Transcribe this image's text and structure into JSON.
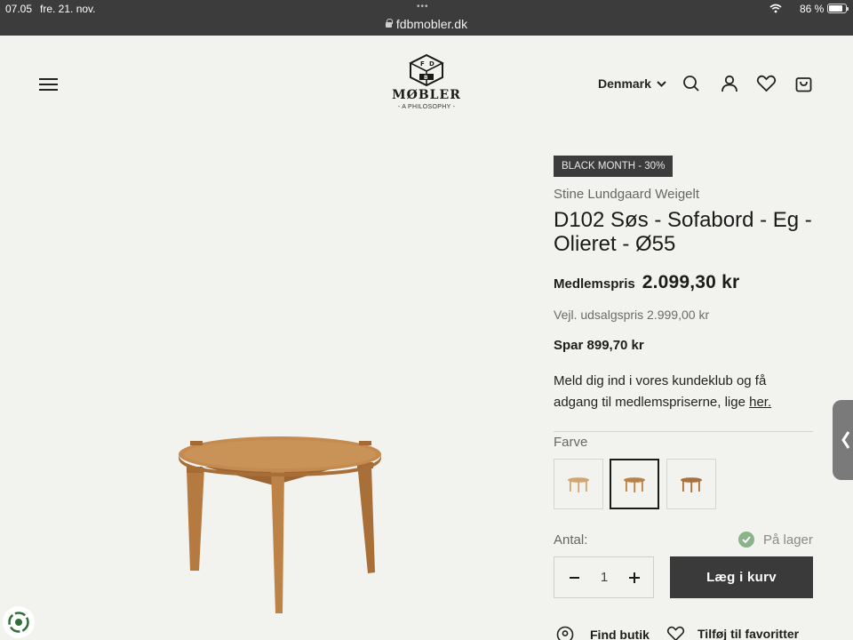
{
  "status_bar": {
    "time": "07.05",
    "date": "fre. 21. nov.",
    "url": "fdbmobler.dk",
    "battery": "86 %",
    "battery_level": 0.86
  },
  "header": {
    "logo_name": "MØBLER",
    "logo_tagline": "- A PHILOSOPHY -",
    "country": "Denmark",
    "icons": [
      "menu-icon",
      "search-icon",
      "account-icon",
      "heart-icon",
      "cart-icon"
    ]
  },
  "product": {
    "badge": "BLACK MONTH - 30%",
    "designer": "Stine Lundgaard Weigelt",
    "title": "D102 Søs - Sofabord - Eg - Olieret - Ø55",
    "member_label": "Medlemspris",
    "member_price": "2.099,30 kr",
    "rrp": "Vejl. udsalgspris 2.999,00 kr",
    "savings": "Spar 899,70 kr",
    "club_text": "Meld dig ind i vores kundeklub og få adgang til medlemspriserne, lige",
    "club_link": "her.",
    "color_label": "Farve",
    "colors": [
      {
        "name": "light-oak",
        "selected": false,
        "hex": "#d2a472"
      },
      {
        "name": "oak-oiled",
        "selected": true,
        "hex": "#b9814a"
      },
      {
        "name": "dark-oak",
        "selected": false,
        "hex": "#a8703d"
      }
    ],
    "quantity_label": "Antal:",
    "quantity": "1",
    "stock": "På lager",
    "add_to_cart": "Læg i kurv",
    "find_store": "Find butik",
    "add_favorite": "Tilføj til favoritter"
  },
  "colors": {
    "background": "#f2f2ee",
    "button_dark": "#3a3a3a",
    "stock_green": "#8bb38a",
    "wood": "#b9814a"
  }
}
